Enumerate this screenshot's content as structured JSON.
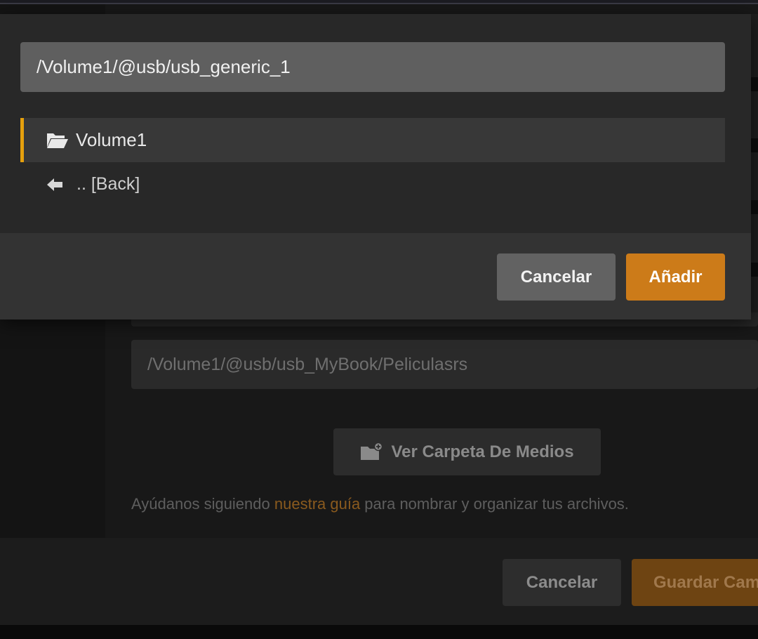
{
  "background": {
    "library_path_value": "/Volume1/@usb/usb_MyBook/Peliculasrs",
    "browse_button_label": "Ver Carpeta De Medios",
    "help_text": {
      "before": "Ayúdanos siguiendo ",
      "link": "nuestra guía",
      "after": " para nombrar y organizar tus archivos."
    },
    "footer": {
      "cancel_label": "Cancelar",
      "save_label": "Guardar Cambios"
    }
  },
  "modal": {
    "path_value": "/Volume1/@usb/usb_generic_1",
    "directories": [
      {
        "label": "Volume1",
        "icon": "folder-open-icon",
        "selected": true
      },
      {
        "label": ".. [Back]",
        "icon": "arrow-left-icon",
        "selected": false
      }
    ],
    "cancel_label": "Cancelar",
    "add_label": "Añadir"
  },
  "colors": {
    "accent": "#e5a00d",
    "primary_button": "#cc7b19",
    "modal_bg": "#282828",
    "selected_row_bg": "#383838"
  }
}
